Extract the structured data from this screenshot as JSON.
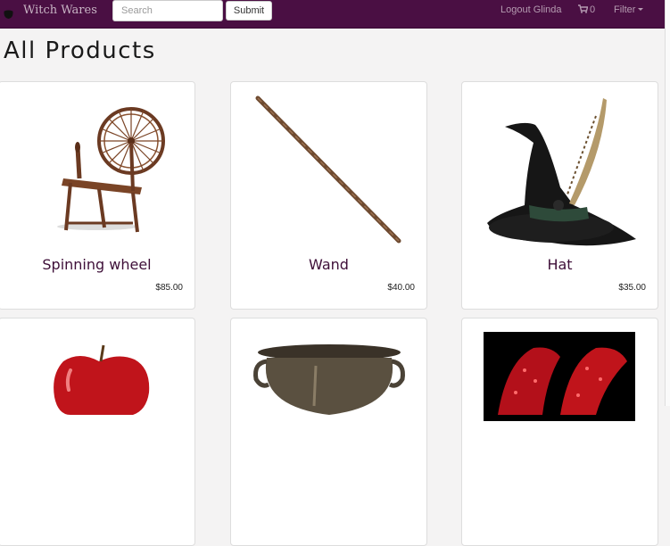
{
  "navbar": {
    "brand": "Witch Wares",
    "search_placeholder": "Search",
    "submit_label": "Submit",
    "logout_label": "Logout Glinda",
    "cart_count": "0",
    "filter_label": "Filter",
    "background_color": "#4a0f43"
  },
  "page": {
    "title": "All Products"
  },
  "products": [
    {
      "name": "Spinning wheel",
      "price": "$85.00",
      "image": "spinning-wheel"
    },
    {
      "name": "Wand",
      "price": "$40.00",
      "image": "wand"
    },
    {
      "name": "Hat",
      "price": "$35.00",
      "image": "witch-hat"
    },
    {
      "name": "",
      "price": "",
      "image": "red-apple"
    },
    {
      "name": "",
      "price": "",
      "image": "cauldron"
    },
    {
      "name": "",
      "price": "",
      "image": "ruby-slippers"
    }
  ]
}
